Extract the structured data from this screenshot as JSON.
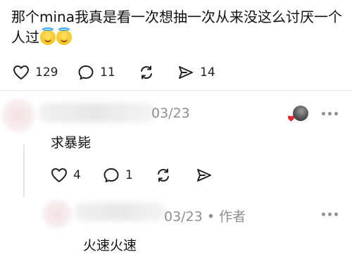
{
  "post": {
    "text": "那个mina我真是看一次想抽一次从来没这么讨厌一个人过",
    "emoji_count": 2,
    "emoji_name": "smiling-face-with-halo",
    "likes": "129",
    "comments": "11",
    "shares": "14"
  },
  "comment1": {
    "time": "03/23",
    "text": "求暴毙",
    "likes": "4",
    "replies": "1"
  },
  "comment2": {
    "time": "03/23",
    "separator": "•",
    "author_tag": "作者",
    "text": "火速火速"
  },
  "colors": {
    "meta": "#8f8f8f",
    "heart_badge": "#e02a2a"
  }
}
